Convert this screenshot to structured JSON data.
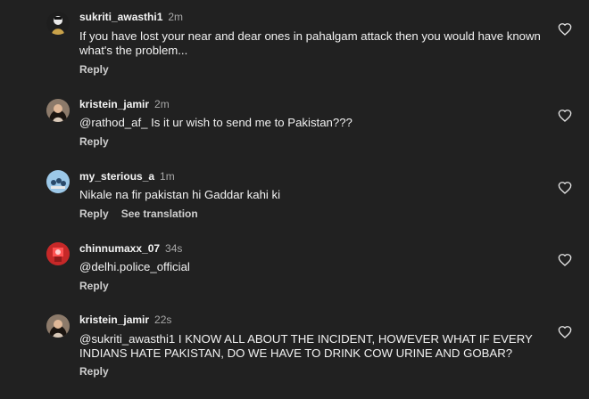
{
  "comments": [
    {
      "username": "sukriti_awasthi1",
      "time": "2m",
      "text": "If you have lost your near and dear ones in pahalgam attack then you would have known what's the problem...",
      "reply_label": "Reply",
      "avatar_icon": "profile-avatar",
      "like_icon": "heart-outline-icon"
    },
    {
      "username": "kristein_jamir",
      "time": "2m",
      "text": "@rathod_af_ Is it ur wish to send me to Pakistan???",
      "reply_label": "Reply",
      "avatar_icon": "profile-avatar",
      "like_icon": "heart-outline-icon"
    },
    {
      "username": "my_sterious_a",
      "time": "1m",
      "text": "Nikale na fir pakistan hi Gaddar kahi ki",
      "reply_label": "Reply",
      "translation_label": "See translation",
      "avatar_icon": "profile-avatar",
      "like_icon": "heart-outline-icon"
    },
    {
      "username": "chinnumaxx_07",
      "time": "34s",
      "text": "@delhi.police_official",
      "reply_label": "Reply",
      "avatar_icon": "profile-avatar",
      "like_icon": "heart-outline-icon"
    },
    {
      "username": "kristein_jamir",
      "time": "22s",
      "text": "@sukriti_awasthi1 I KNOW ALL ABOUT THE INCIDENT, HOWEVER WHAT IF EVERY INDIANS HATE  PAKISTAN, DO WE HAVE TO DRINK COW URINE AND GOBAR?",
      "reply_label": "Reply",
      "avatar_icon": "profile-avatar",
      "like_icon": "heart-outline-icon"
    }
  ],
  "colors": {
    "background": "#212121",
    "text": "#f2f2f2",
    "secondary_text": "#a8a8a8"
  }
}
